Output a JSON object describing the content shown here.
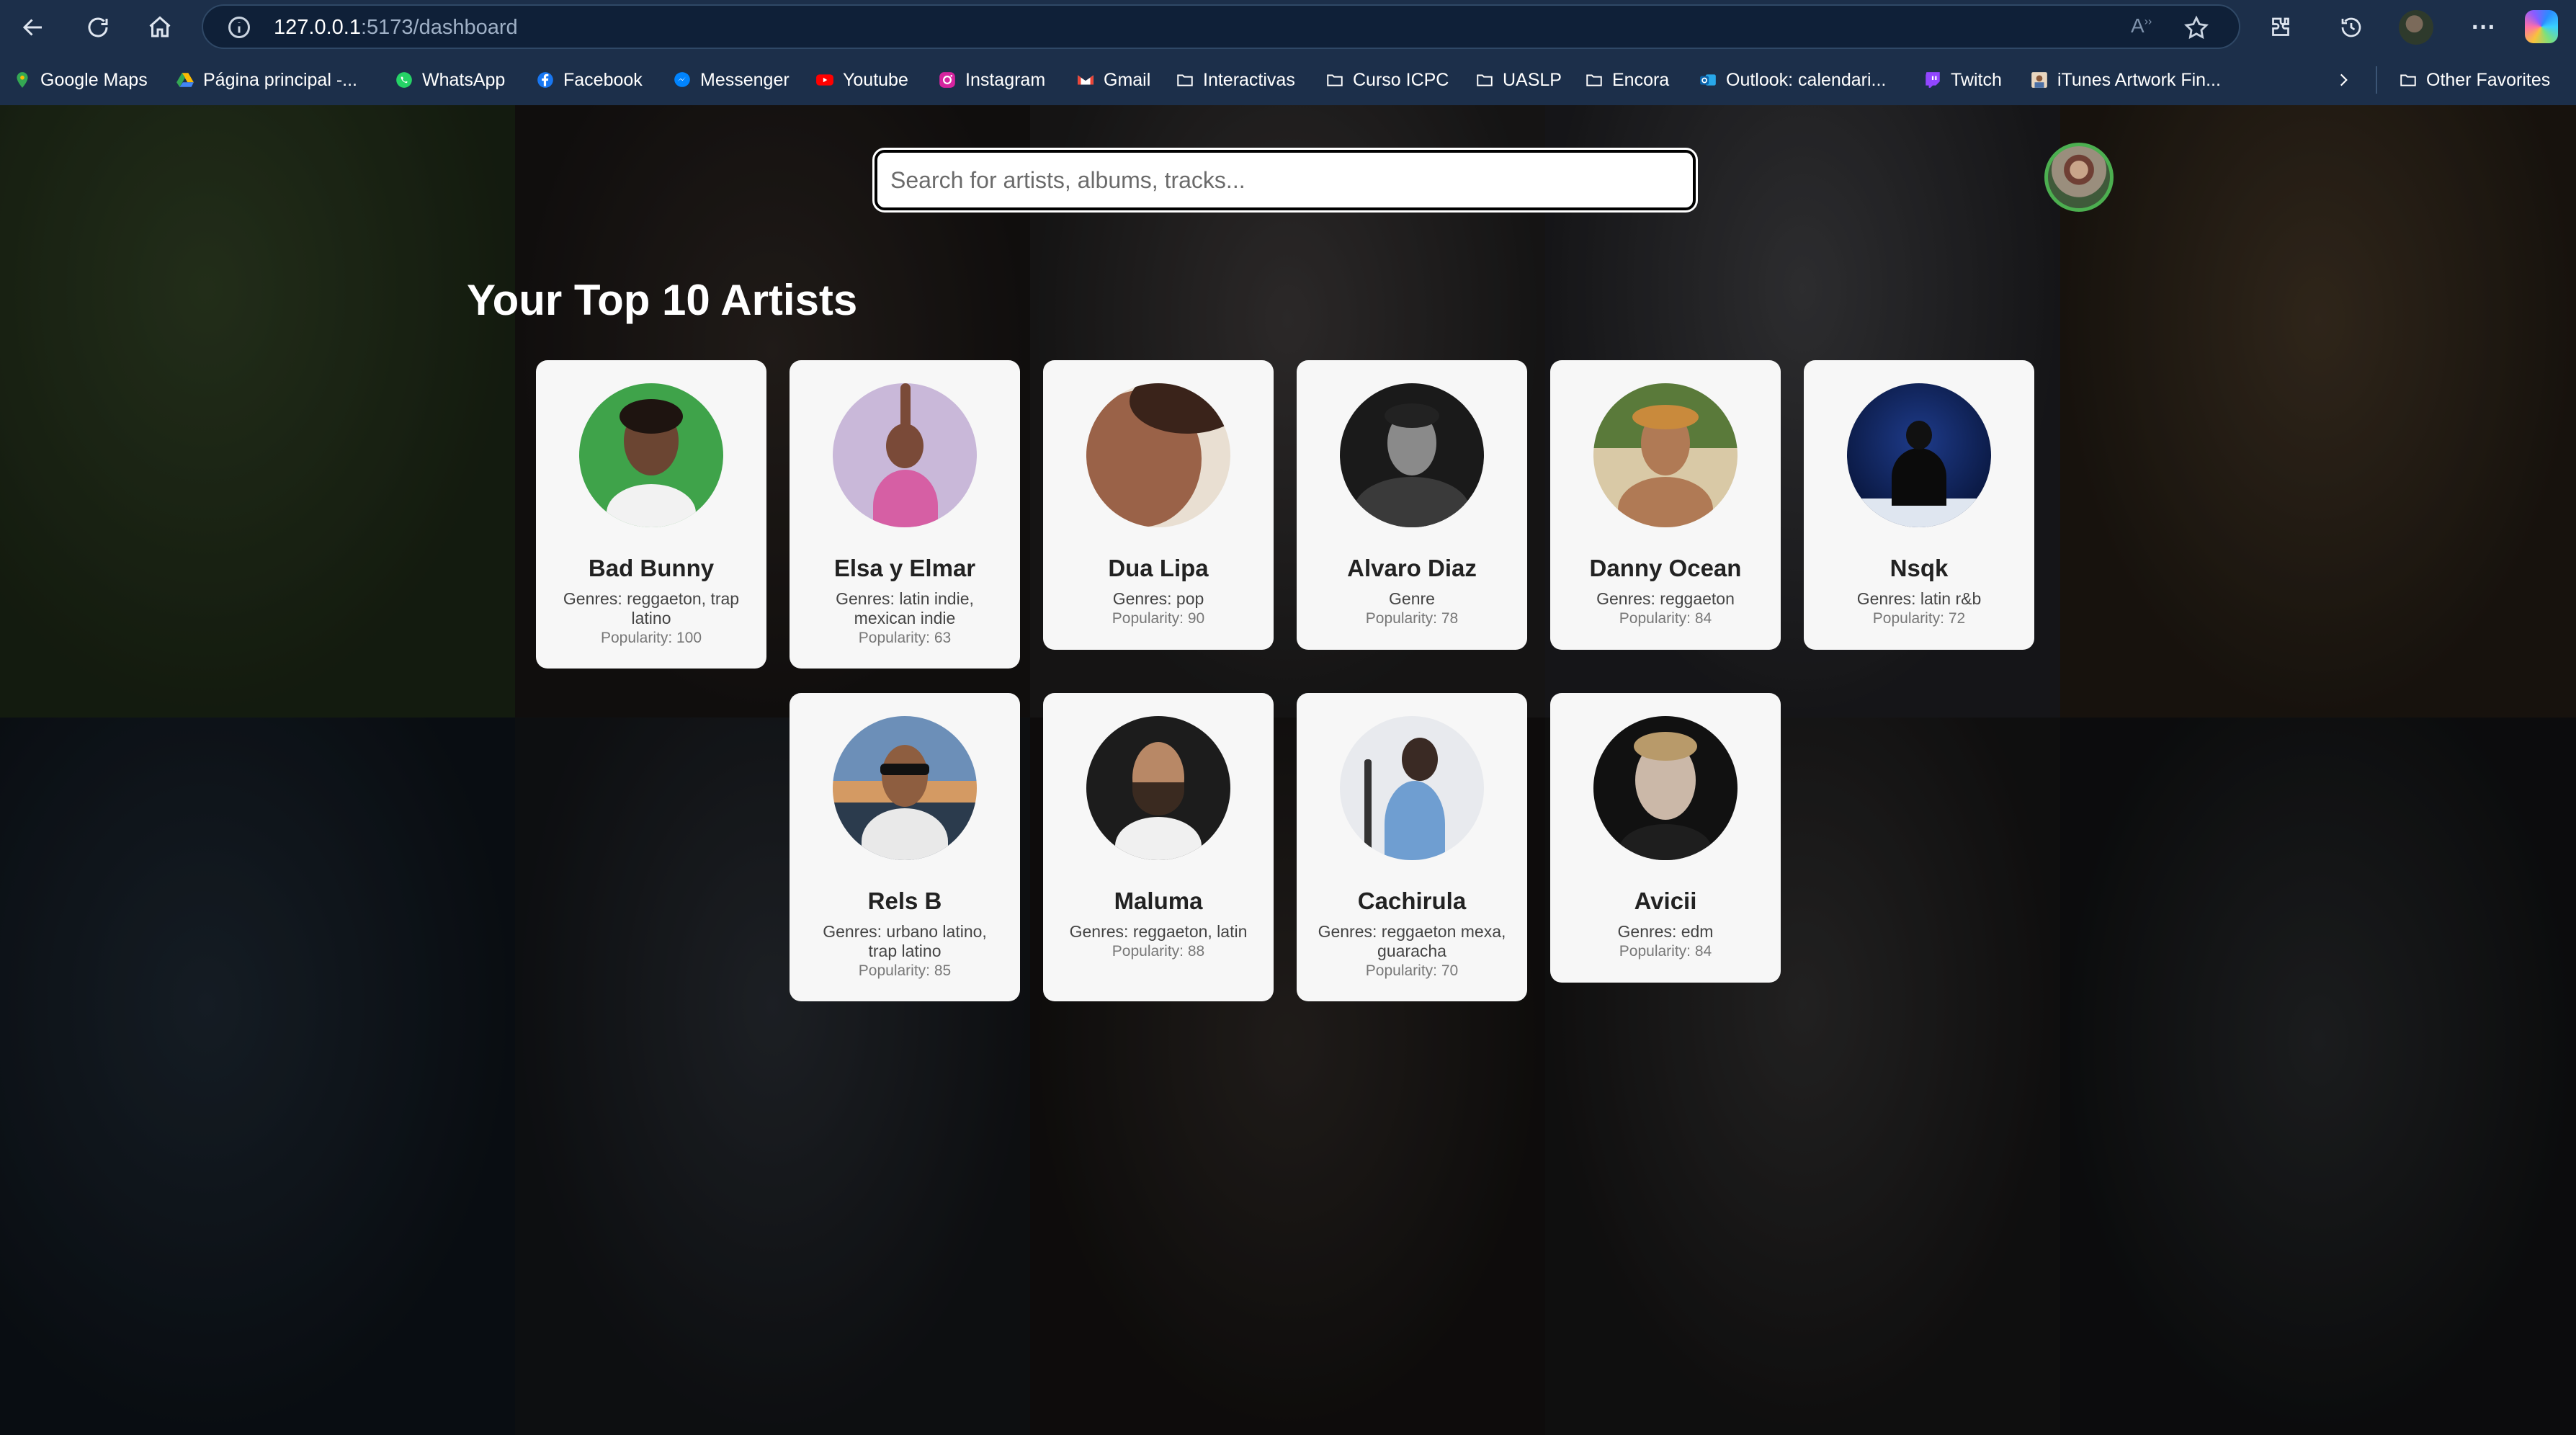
{
  "browser": {
    "url_host": "127.0.0.1",
    "url_path": ":5173/dashboard",
    "bookmarks": [
      {
        "label": "Google Maps",
        "icon": "maps-pin-icon"
      },
      {
        "label": "Página principal -...",
        "icon": "drive-icon"
      },
      {
        "label": "WhatsApp",
        "icon": "whatsapp-icon"
      },
      {
        "label": "Facebook",
        "icon": "facebook-icon"
      },
      {
        "label": "Messenger",
        "icon": "messenger-icon"
      },
      {
        "label": "Youtube",
        "icon": "youtube-icon"
      },
      {
        "label": "Instagram",
        "icon": "instagram-icon"
      },
      {
        "label": "Gmail",
        "icon": "gmail-icon"
      },
      {
        "label": "Interactivas",
        "icon": "folder-icon"
      },
      {
        "label": "Curso ICPC",
        "icon": "folder-icon"
      },
      {
        "label": "UASLP",
        "icon": "folder-icon"
      },
      {
        "label": "Encora",
        "icon": "folder-icon"
      },
      {
        "label": "Outlook: calendari...",
        "icon": "outlook-icon"
      },
      {
        "label": "Twitch",
        "icon": "twitch-icon"
      },
      {
        "label": "iTunes Artwork Fin...",
        "icon": "itunes-icon"
      }
    ],
    "other_favorites": "Other Favorites"
  },
  "search": {
    "placeholder": "Search for artists, albums, tracks..."
  },
  "heading": "Your Top 10 Artists",
  "artists": [
    {
      "name": "Bad Bunny",
      "genres": "Genres: reggaeton, trap latino",
      "popularity": "Popularity: 100"
    },
    {
      "name": "Elsa y Elmar",
      "genres": "Genres: latin indie, mexican indie",
      "popularity": "Popularity: 63"
    },
    {
      "name": "Dua Lipa",
      "genres": "Genres: pop",
      "popularity": "Popularity: 90"
    },
    {
      "name": "Alvaro Diaz",
      "genres": "Genre",
      "popularity": "Popularity: 78"
    },
    {
      "name": "Danny Ocean",
      "genres": "Genres: reggaeton",
      "popularity": "Popularity: 84"
    },
    {
      "name": "Nsqk",
      "genres": "Genres: latin r&b",
      "popularity": "Popularity: 72"
    },
    {
      "name": "Rels B",
      "genres": "Genres: urbano latino, trap latino",
      "popularity": "Popularity: 85"
    },
    {
      "name": "Maluma",
      "genres": "Genres: reggaeton, latin",
      "popularity": "Popularity: 88"
    },
    {
      "name": "Cachirula",
      "genres": "Genres: reggaeton mexa, guaracha",
      "popularity": "Popularity: 70"
    },
    {
      "name": "Avicii",
      "genres": "Genres: edm",
      "popularity": "Popularity: 84"
    }
  ],
  "colors": {
    "chrome_bg": "#1c2f4a",
    "card_bg": "#f7f7f7",
    "avatar_ring": "#4caf50"
  }
}
